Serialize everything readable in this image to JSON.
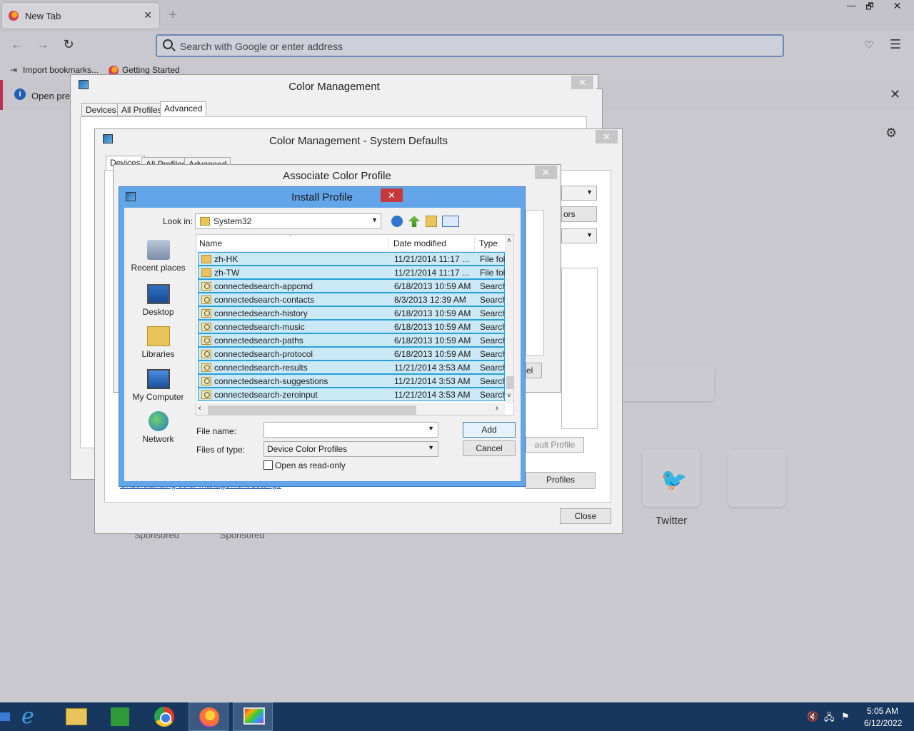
{
  "browser": {
    "tab_title": "New Tab",
    "tab_close": "✕",
    "new_tab": "+",
    "window_controls": {
      "minimize": "—",
      "maximize": "🗗",
      "close": "✕"
    },
    "nav": {
      "back": "←",
      "forward": "→",
      "reload": "↻"
    },
    "url_placeholder": "Search with Google or enter address",
    "pocket_icon": "♡",
    "menu_icon": "☰",
    "bookmarks": [
      "Import bookmarks...",
      "Getting Started"
    ],
    "notice_text": "Open prev",
    "notice_close": "✕",
    "settings_icon": "⚙",
    "top_sites": {
      "twitter_label": "Twitter",
      "sponsored": "Sponsored"
    }
  },
  "color_management": {
    "title": "Color Management",
    "close": "✕",
    "tabs": [
      "Devices",
      "All Profiles",
      "Advanced"
    ],
    "active_tab": "Advanced"
  },
  "system_defaults": {
    "title": "Color Management - System Defaults",
    "close": "✕",
    "tabs": [
      "Devices",
      "All Profiles",
      "Advanced"
    ],
    "partial_button": "ors",
    "partial_button2": "el",
    "set_default_partial": "ault Profile",
    "profiles_button": "Profiles",
    "link_text": "Understanding color management settings",
    "close_button": "Close"
  },
  "associate": {
    "title": "Associate Color Profile",
    "close": "✕"
  },
  "install_profile": {
    "title": "Install Profile",
    "close": "✕",
    "look_in_label": "Look in:",
    "look_in_value": "System32",
    "places": [
      "Recent places",
      "Desktop",
      "Libraries",
      "My Computer",
      "Network"
    ],
    "columns": [
      "Name",
      "Date modified",
      "Type"
    ],
    "files": [
      {
        "name": "zh-HK",
        "date": "11/21/2014 11:17 ...",
        "type": "File fol",
        "kind": "folder"
      },
      {
        "name": "zh-TW",
        "date": "11/21/2014 11:17 ...",
        "type": "File fol",
        "kind": "folder"
      },
      {
        "name": "connectedsearch-appcmd",
        "date": "6/18/2013 10:59 AM",
        "type": "Search",
        "kind": "search"
      },
      {
        "name": "connectedsearch-contacts",
        "date": "8/3/2013 12:39 AM",
        "type": "Search",
        "kind": "search"
      },
      {
        "name": "connectedsearch-history",
        "date": "6/18/2013 10:59 AM",
        "type": "Search",
        "kind": "search"
      },
      {
        "name": "connectedsearch-music",
        "date": "6/18/2013 10:59 AM",
        "type": "Search",
        "kind": "search"
      },
      {
        "name": "connectedsearch-paths",
        "date": "6/18/2013 10:59 AM",
        "type": "Search",
        "kind": "search"
      },
      {
        "name": "connectedsearch-protocol",
        "date": "6/18/2013 10:59 AM",
        "type": "Search",
        "kind": "search"
      },
      {
        "name": "connectedsearch-results",
        "date": "11/21/2014 3:53 AM",
        "type": "Search",
        "kind": "search"
      },
      {
        "name": "connectedsearch-suggestions",
        "date": "11/21/2014 3:53 AM",
        "type": "Search",
        "kind": "search"
      },
      {
        "name": "connectedsearch-zeroinput",
        "date": "11/21/2014 3:53 AM",
        "type": "Search",
        "kind": "search"
      }
    ],
    "file_name_label": "File name:",
    "file_name_value": "",
    "file_type_label": "Files of type:",
    "file_type_value": "Device Color Profiles",
    "read_only_label": "Open as read-only",
    "read_only_checked": false,
    "add_button": "Add",
    "cancel_button": "Cancel"
  },
  "taskbar": {
    "apps": [
      "Internet Explorer",
      "File Explorer",
      "Store",
      "Google Chrome",
      "Firefox",
      "Color Management"
    ],
    "active_app": "Firefox",
    "time": "5:05 AM",
    "date": "6/12/2022"
  }
}
